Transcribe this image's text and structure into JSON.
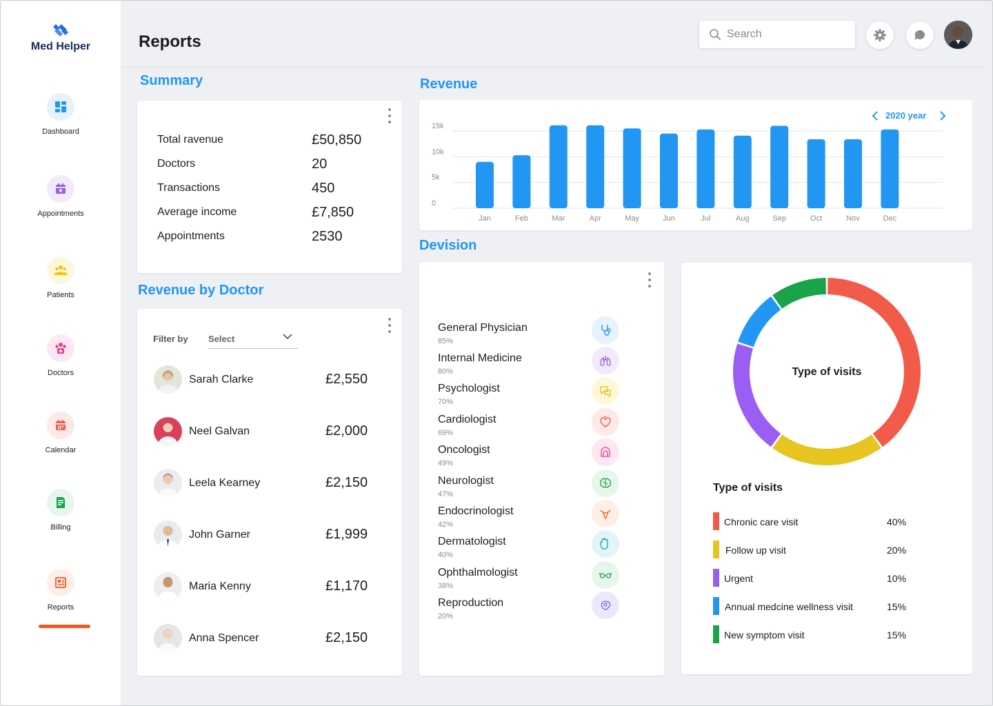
{
  "app": {
    "name": "Med Helper"
  },
  "sidebar": {
    "items": [
      {
        "label": "Dashboard",
        "icon": "dashboard-icon",
        "color": "#2196f3",
        "bg": "#e6f2fd"
      },
      {
        "label": "Appointments",
        "icon": "calendar-plus-icon",
        "color": "#9b5de5",
        "bg": "#f1eafb"
      },
      {
        "label": "Patients",
        "icon": "patients-icon",
        "color": "#f4c20d",
        "bg": "#fdf7dc"
      },
      {
        "label": "Doctors",
        "icon": "doctors-icon",
        "color": "#e83e8c",
        "bg": "#fde8f1"
      },
      {
        "label": "Calendar",
        "icon": "calendar-icon",
        "color": "#f25a4a",
        "bg": "#fde9e7"
      },
      {
        "label": "Billing",
        "icon": "billing-icon",
        "color": "#19a34a",
        "bg": "#e6f6ec"
      },
      {
        "label": "Reports",
        "icon": "reports-icon",
        "color": "#ee5a24",
        "bg": "#fdeee6"
      }
    ],
    "active": "Reports",
    "active_color": "#ee5a24"
  },
  "header": {
    "title": "Reports",
    "search_placeholder": "Search"
  },
  "summary": {
    "title": "Summary",
    "rows": [
      {
        "label": "Total ravenue",
        "value": "£50,850"
      },
      {
        "label": "Doctors",
        "value": "20"
      },
      {
        "label": "Transactions",
        "value": "450"
      },
      {
        "label": "Average income",
        "value": "£7,850"
      },
      {
        "label": "Appointments",
        "value": "2530"
      }
    ]
  },
  "revenue_by_doctor": {
    "title": "Revenue by Doctor",
    "filter_label": "Filter by",
    "filter_value": "Select",
    "doctors": [
      {
        "name": "Sarah Clarke",
        "amount": "£2,550"
      },
      {
        "name": "Neel Galvan",
        "amount": "£2,000"
      },
      {
        "name": "Leela Kearney",
        "amount": "£2,150"
      },
      {
        "name": "John Garner",
        "amount": "£1,999"
      },
      {
        "name": "Maria Kenny",
        "amount": "£1,170"
      },
      {
        "name": "Anna Spencer",
        "amount": "£2,150"
      }
    ]
  },
  "revenue": {
    "title": "Revenue",
    "year_label": "2020 year"
  },
  "division": {
    "title": "Devision",
    "items": [
      {
        "name": "General Physician",
        "pct": "85%",
        "icon": "stethoscope-icon",
        "color": "#2196f3",
        "bg": "#e6f2fd"
      },
      {
        "name": "Internal Medicine",
        "pct": "80%",
        "icon": "lungs-icon",
        "color": "#9b5de5",
        "bg": "#f1eafb"
      },
      {
        "name": "Psychologist",
        "pct": "70%",
        "icon": "chat-brain-icon",
        "color": "#e6c20d",
        "bg": "#fdf7dc"
      },
      {
        "name": "Cardiologist",
        "pct": "69%",
        "icon": "heart-icon",
        "color": "#f25a4a",
        "bg": "#fde9e7"
      },
      {
        "name": "Oncologist",
        "pct": "49%",
        "icon": "oncology-icon",
        "color": "#e83e8c",
        "bg": "#fde8f1"
      },
      {
        "name": "Neurologist",
        "pct": "47%",
        "icon": "brain-icon",
        "color": "#19a34a",
        "bg": "#e6f6ec"
      },
      {
        "name": "Endocrinologist",
        "pct": "42%",
        "icon": "thyroid-icon",
        "color": "#ee5a24",
        "bg": "#fdeee6"
      },
      {
        "name": "Dermatologist",
        "pct": "40%",
        "icon": "hand-icon",
        "color": "#17a2b8",
        "bg": "#e2f5f8"
      },
      {
        "name": "Ophthalmologist",
        "pct": "38%",
        "icon": "glasses-icon",
        "color": "#19a34a",
        "bg": "#e6f6ec"
      },
      {
        "name": "Reproduction",
        "pct": "20%",
        "icon": "reproduction-icon",
        "color": "#7b5de5",
        "bg": "#ece8fb"
      }
    ]
  },
  "visits": {
    "center_label": "Type of visits",
    "legend_title": "Type of visits",
    "items": [
      {
        "name": "Chronic care visit",
        "pct": "40%",
        "color": "#f25a4a"
      },
      {
        "name": "Follow up visit",
        "pct": "20%",
        "color": "#e6c520"
      },
      {
        "name": "Urgent",
        "pct": "10%",
        "color": "#9b5ef5"
      },
      {
        "name": "Annual medcine wellness visit",
        "pct": "15%",
        "color": "#2196f3"
      },
      {
        "name": "New symptom visit",
        "pct": "15%",
        "color": "#19a34a"
      }
    ]
  },
  "chart_data": [
    {
      "type": "bar",
      "categories": [
        "Jan",
        "Feb",
        "Mar",
        "Apr",
        "May",
        "Jun",
        "Jul",
        "Aug",
        "Sep",
        "Oct",
        "Nov",
        "Dec"
      ],
      "values": [
        9000,
        10300,
        16100,
        16100,
        15500,
        14500,
        15300,
        14100,
        16000,
        13400,
        13400,
        15300
      ],
      "ytick_labels": [
        "0",
        "5k",
        "10k",
        "15k"
      ],
      "yticks": [
        0,
        5000,
        10000,
        15000
      ],
      "ylim": [
        0,
        15000
      ],
      "grid": true,
      "color": "#2196f3"
    },
    {
      "type": "pie",
      "donut": true,
      "labels": [
        "Chronic care visit",
        "Follow up visit",
        "Urgent",
        "Annual medcine wellness visit",
        "New symptom visit"
      ],
      "values": [
        40,
        20,
        20,
        10,
        10
      ],
      "colors": [
        "#f25a4a",
        "#e6c520",
        "#9b5ef5",
        "#2196f3",
        "#19a34a"
      ]
    }
  ]
}
